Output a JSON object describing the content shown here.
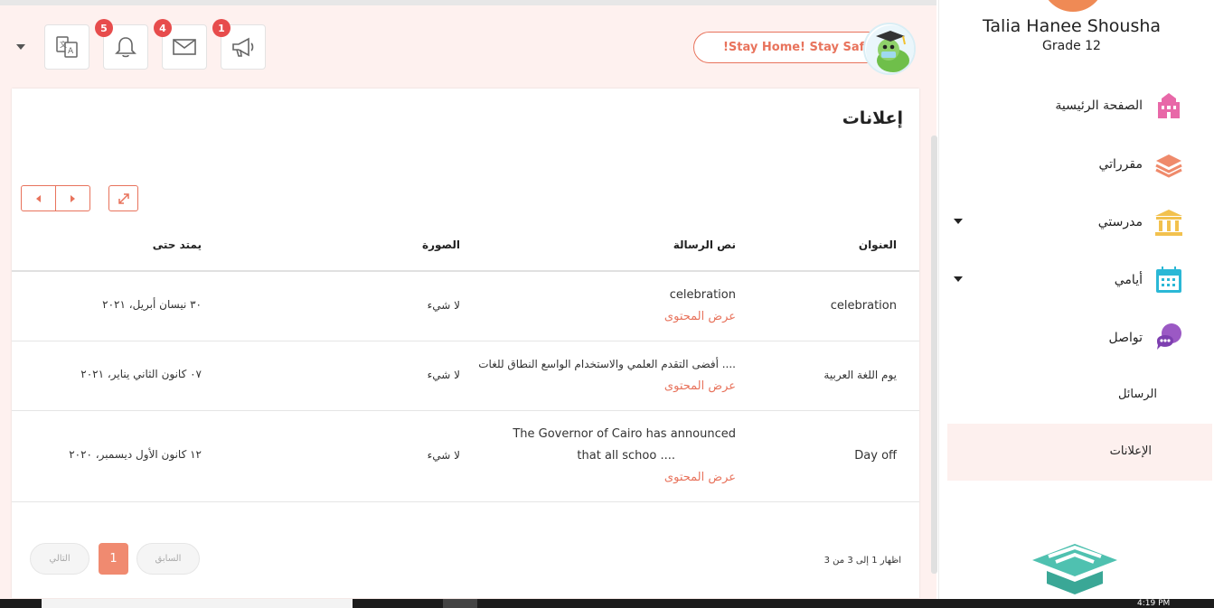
{
  "header": {
    "badges": {
      "notifications": "5",
      "messages": "4",
      "announcements": "1"
    },
    "slogan": "!Stay Home! Stay Safe"
  },
  "card": {
    "title": "إعلانات",
    "columns": {
      "title": "العنوان",
      "message": "نص الرسالة",
      "image": "الصورة",
      "valid_until": "يمتد حتى"
    },
    "rows": [
      {
        "title": "celebration",
        "message_line1": "celebration",
        "message_line2": "",
        "link": "عرض المحتوى",
        "image": "لا شيء",
        "valid_until": "٣٠ نيسان أبريل، ٢٠٢١"
      },
      {
        "title": "يوم اللغة العربية",
        "message_line1": "أفضى التقدم العلمي والاستخدام الواسع النطاق للغات ....",
        "message_line2": "",
        "link": "عرض المحتوى",
        "image": "لا شيء",
        "valid_until": "٠٧ كانون الثاني يناير، ٢٠٢١"
      },
      {
        "title": "Day off",
        "message_line1": "The Governor of Cairo has announced",
        "message_line2": "that all schoo ....",
        "link": "عرض المحتوى",
        "image": "لا شيء",
        "valid_until": "١٢ كانون الأول ديسمبر، ٢٠٢٠"
      }
    ],
    "pagination": {
      "info": "اظهار 1 إلى 3 من 3",
      "previous": "السابق",
      "current": "1",
      "next": "التالي"
    }
  },
  "sidebar": {
    "user_name": "Talia Hanee Shousha",
    "grade": "Grade 12",
    "items": [
      {
        "label": "الصفحة الرئيسية",
        "icon": "school-building-icon"
      },
      {
        "label": "مقرراتي",
        "icon": "stacked-books-icon"
      },
      {
        "label": "مدرستي",
        "icon": "institution-icon"
      },
      {
        "label": "أيامي",
        "icon": "calendar-icon"
      },
      {
        "label": "تواصل",
        "icon": "chat-bubbles-icon"
      }
    ],
    "sub_items": {
      "messages": "الرسائل",
      "announcements": "الإعلانات"
    }
  },
  "taskbar": {
    "time": "4:19 PM"
  },
  "colors": {
    "accent": "#e8735c",
    "badge": "#e74c4c",
    "header_bg": "#fef1ef"
  }
}
